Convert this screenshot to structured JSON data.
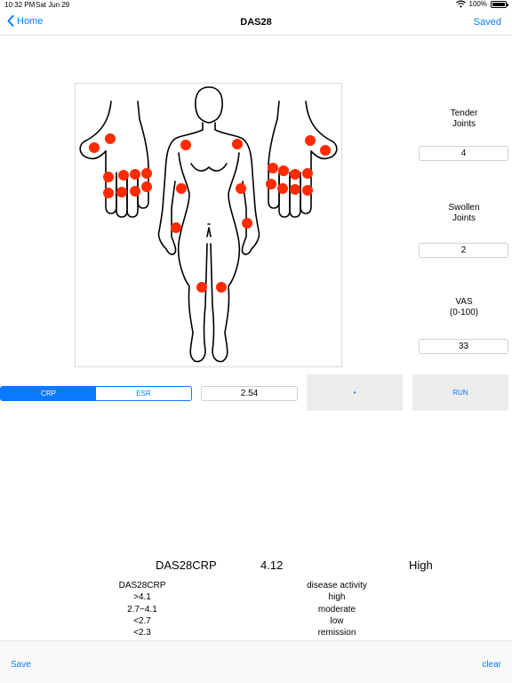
{
  "status": {
    "time": "10:32 PM",
    "date": "Sat Jun 29",
    "battery": "100%"
  },
  "nav": {
    "back_label": "Home",
    "title": "DAS28",
    "right_label": "Saved"
  },
  "fields": {
    "tender": {
      "label_line1": "Tender",
      "label_line2": "Joints",
      "value": "4"
    },
    "swollen": {
      "label_line1": "Swollen",
      "label_line2": "Joints",
      "value": "2"
    },
    "vas": {
      "label_line1": "VAS",
      "label_line2": "(0-100)",
      "value": "33"
    }
  },
  "marker": {
    "options": [
      "CRP",
      "ESR"
    ],
    "selected": "CRP",
    "value": "2.54"
  },
  "buttons": {
    "dot_label": "•",
    "run_label": "RUN"
  },
  "result": {
    "score_name": "DAS28CRP",
    "score": "4.12",
    "activity": "High"
  },
  "table": {
    "header": [
      "DAS28CRP",
      "disease activity"
    ],
    "rows": [
      [
        ">4.1",
        "high"
      ],
      [
        "2.7~4.1",
        "moderate"
      ],
      [
        "<2.7",
        "low"
      ],
      [
        "<2.3",
        "remission"
      ]
    ]
  },
  "bottom": {
    "save_label": "Save",
    "clear_label": "clear"
  },
  "colors": {
    "accent": "#0a7aff",
    "joint_marker": "#ff2a00"
  }
}
